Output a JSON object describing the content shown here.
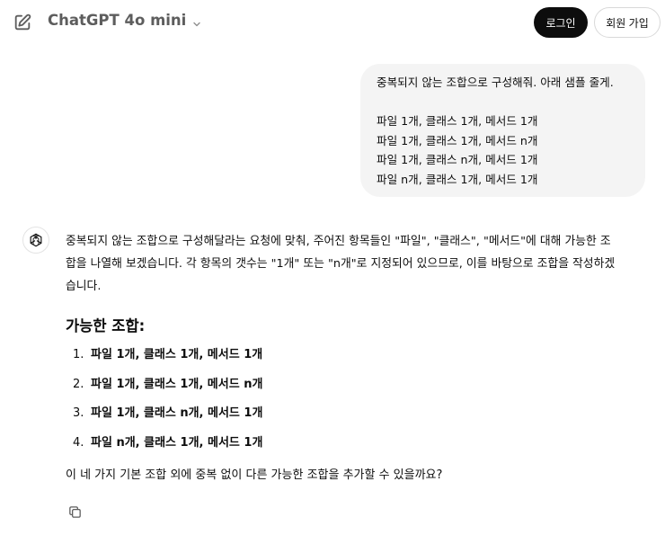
{
  "header": {
    "model_name": "ChatGPT 4o mini",
    "login_label": "로그인",
    "signup_label": "회원 가입"
  },
  "user_message": {
    "lines": [
      "중복되지 않는 조합으로 구성해줘. 아래 샘플 줄게.",
      "",
      "파일 1개, 클래스 1개, 메서드 1개",
      "파일 1개, 클래스 1개, 메서드 n개",
      "파일 1개, 클래스 n개, 메서드 1개",
      "파일 n개, 클래스 1개, 메서드 1개"
    ]
  },
  "assistant_message": {
    "intro_lines": [
      "중복되지 않는 조합으로 구성해달라는 요청에 맞춰, 주어진 항목들인 \"파일\", \"클래스\", \"메서드\"에 대해 가능한 조",
      "합을 나열해 보겠습니다. 각 항목의 갯수는 \"1개\" 또는 \"n개\"로 지정되어 있으므로, 이를 바탕으로 조합을 작성하겠",
      "습니다."
    ],
    "heading": "가능한 조합:",
    "items": [
      {
        "num": "1.",
        "text": "파일 1개, 클래스 1개, 메서드 1개"
      },
      {
        "num": "2.",
        "text": "파일 1개, 클래스 1개, 메서드 n개"
      },
      {
        "num": "3.",
        "text": "파일 1개, 클래스 n개, 메서드 1개"
      },
      {
        "num": "4.",
        "text": "파일 n개, 클래스 1개, 메서드 1개"
      }
    ],
    "closing": "이 네 가지 기본 조합 외에 중복 없이 다른 가능한 조합을 추가할 수 있을까요?"
  },
  "icons": {
    "new_chat": "edit-icon",
    "model_dropdown": "chevron-down-icon",
    "assistant_avatar": "openai-logo-icon",
    "copy": "copy-icon"
  }
}
